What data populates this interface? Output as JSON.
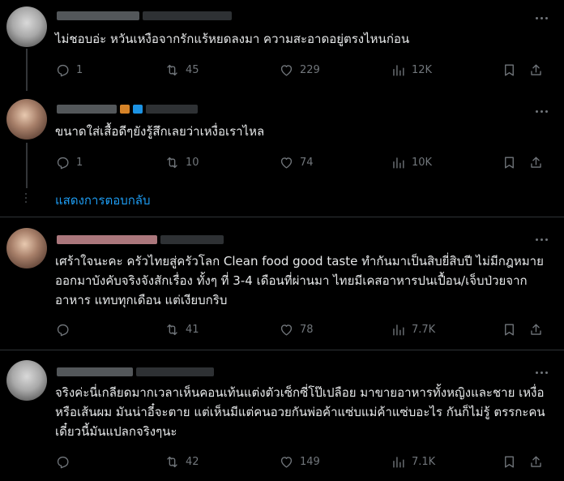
{
  "tweets": [
    {
      "text": "ไม่ชอบอ่ะ หวันเหงือจากรักแร้หยดลงมา ความสะอาดอยู่ตรงไหนก่อน",
      "replies": "1",
      "retweets": "45",
      "likes": "229",
      "views": "12K"
    },
    {
      "text": "ขนาดใส่เสื้อดีๆยังรู้สึกเลยว่าเหงื่อเราไหล",
      "replies": "1",
      "retweets": "10",
      "likes": "74",
      "views": "10K"
    },
    {
      "text": "เศร้าใจนะคะ ครัวไทยสู่ครัวโลก Clean food good taste ทำกันมาเป็นสิบยี่สิบปี ไม่มีกฎหมายออกมาบังคับจริงจังสักเรื่อง ทั้งๆ ที่ 3-4 เดือนที่ผ่านมา ไทยมีเคสอาหารปนเปื้อน/เจ็บป่วยจากอาหาร แทบทุกเดือน แต่เงียบกริบ",
      "replies": "",
      "retweets": "41",
      "likes": "78",
      "views": "7.7K"
    },
    {
      "text": "จริงค่ะนี่เกลียดมากเวลาเห็นคอนเท้นแต่งตัวเซ็กซี่โป๊เปลือย มาขายอาหารทั้งหญิงและชาย เหงื่อหรือเส้นผม มันน่าอี๋จะตาย แต่เห็นมีแต่คนอวยกันพ่อค้าแซ่บแม่ค้าแซ่บอะไร กันก็ไม่รู้ ตรรกะคนเดี๋ยวนี้มันแปลกจริงๆนะ",
      "replies": "",
      "retweets": "42",
      "likes": "149",
      "views": "7.1K"
    }
  ],
  "show_replies_label": "แสดงการตอบกลับ",
  "colors": {
    "background": "#000000",
    "text": "#e7e9ea",
    "muted": "#71767b",
    "link": "#1d9bf0",
    "divider": "#2f3336"
  },
  "icons": [
    "reply-icon",
    "retweet-icon",
    "like-icon",
    "views-icon",
    "bookmark-icon",
    "share-icon",
    "more-icon"
  ]
}
